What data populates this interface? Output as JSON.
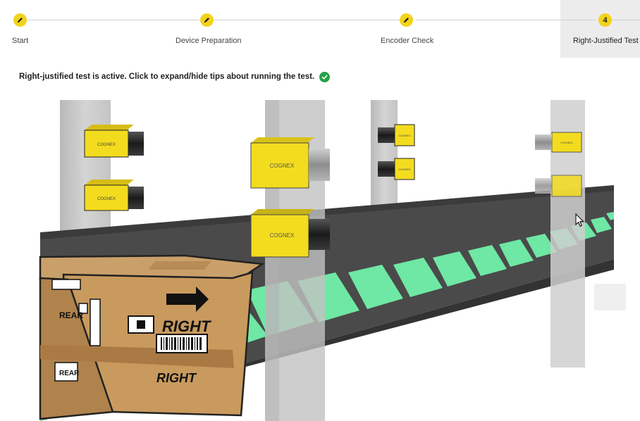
{
  "stepper": {
    "steps": [
      {
        "label": "Start",
        "status": "done",
        "icon": "pencil-icon"
      },
      {
        "label": "Device Preparation",
        "status": "done",
        "icon": "pencil-icon"
      },
      {
        "label": "Encoder Check",
        "status": "done",
        "icon": "pencil-icon"
      },
      {
        "label": "Right-Justified Test",
        "status": "active",
        "number": "4"
      }
    ],
    "accent_color": "#f2d31b"
  },
  "message": {
    "text": "Right-justified test is active. Click to expand/hide tips about running the test.",
    "icon": "check-circle-icon",
    "icon_color": "#27a046"
  },
  "illustration": {
    "camera_brand": "COGNEX",
    "box_labels": {
      "side_top": "RIGHT",
      "side_bottom": "RIGHT",
      "end_top": "REAR",
      "end_bottom": "REAR"
    },
    "belt_stripe_color": "#6ee8a4",
    "camera_color": "#f3dc1e"
  }
}
